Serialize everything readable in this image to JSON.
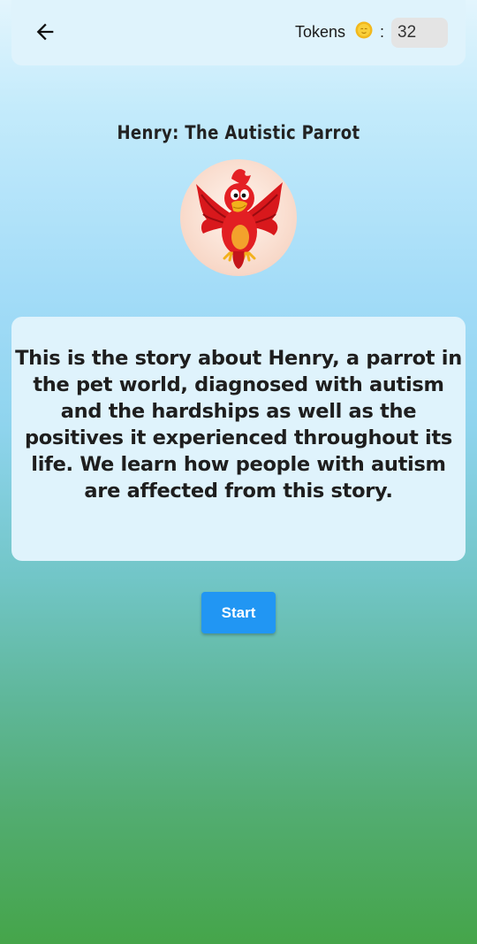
{
  "header": {
    "tokens_label": "Tokens",
    "separator": ":",
    "token_count": "32",
    "back_icon": "arrow-left-icon",
    "coin_icon": "coin-icon"
  },
  "story": {
    "title": "Henry: The Autistic Parrot",
    "image_icon": "red-parrot-illustration",
    "description": "This is the story about Henry, a parrot in the pet world, diagnosed with autism and the hardships as well as the positives it experienced throughout its life.  We learn how people with autism are affected from this story."
  },
  "actions": {
    "start_label": "Start",
    "start_color": "#2196f3"
  }
}
